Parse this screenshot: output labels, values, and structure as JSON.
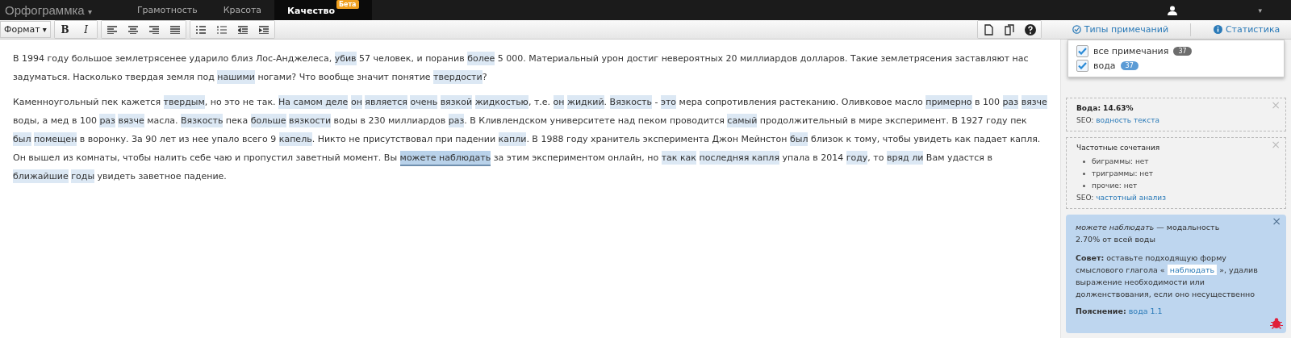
{
  "topbar": {
    "brand": "Орфограммка",
    "brand_caret": "▾",
    "tabs": [
      {
        "label": "Грамотность",
        "selected": false
      },
      {
        "label": "Красота",
        "selected": false
      },
      {
        "label": "Качество",
        "selected": true,
        "badge": "Бета"
      }
    ],
    "user_caret": "▾"
  },
  "toolbar": {
    "format": "Формат",
    "format_caret": "▾",
    "bold": "B",
    "italic": "I",
    "types_link": "Типы примечаний",
    "stats_link": "Статистика"
  },
  "paragraphs": [
    [
      {
        "text": "В 1994 году большое землетрясенее ударило близ Лос-Анджелеса, ",
        "kind": "plain"
      },
      {
        "text": "убив",
        "kind": "note"
      },
      {
        "text": " 57 человек, и поранив ",
        "kind": "plain"
      },
      {
        "text": "более",
        "kind": "note"
      },
      {
        "text": " 5 000. Материальный урон достиг невероятных 20 миллиардов долларов. Такие землетрясения заставляют нас задуматься. Насколько твердая земля под ",
        "kind": "plain"
      },
      {
        "text": "нашими",
        "kind": "note"
      },
      {
        "text": " ногами? Что вообще значит понятие ",
        "kind": "plain"
      },
      {
        "text": "твердости",
        "kind": "note"
      },
      {
        "text": "?",
        "kind": "plain"
      }
    ],
    [
      {
        "text": "Каменноугольный пек кажется ",
        "kind": "plain"
      },
      {
        "text": "твердым",
        "kind": "note"
      },
      {
        "text": ", но это не так. ",
        "kind": "plain"
      },
      {
        "text": "На самом деле",
        "kind": "note"
      },
      {
        "text": "он",
        "kind": "note"
      },
      {
        "text": "является",
        "kind": "note"
      },
      {
        "text": "очень",
        "kind": "note"
      },
      {
        "text": "вязкой",
        "kind": "note"
      },
      {
        "text": "жидкостью",
        "kind": "note"
      },
      {
        "text": ", т.е. ",
        "kind": "plain"
      },
      {
        "text": "он",
        "kind": "note"
      },
      {
        "text": "жидкий",
        "kind": "note"
      },
      {
        "text": ". ",
        "kind": "plain"
      },
      {
        "text": "Вязкость",
        "kind": "note"
      },
      {
        "text": " - ",
        "kind": "plain"
      },
      {
        "text": "это",
        "kind": "note"
      },
      {
        "text": " мера сопротивления растеканию. Оливковое масло ",
        "kind": "plain"
      },
      {
        "text": "примерно",
        "kind": "note"
      },
      {
        "text": " в 100 ",
        "kind": "plain"
      },
      {
        "text": "раз",
        "kind": "note"
      },
      {
        "text": "вязче",
        "kind": "note"
      },
      {
        "text": " воды, а мед в 100 ",
        "kind": "plain"
      },
      {
        "text": "раз",
        "kind": "note"
      },
      {
        "text": "вязче",
        "kind": "note"
      },
      {
        "text": " масла. ",
        "kind": "plain"
      },
      {
        "text": "Вязкость",
        "kind": "note"
      },
      {
        "text": " пека ",
        "kind": "plain"
      },
      {
        "text": "больше",
        "kind": "note"
      },
      {
        "text": "вязкости",
        "kind": "note"
      },
      {
        "text": " воды в 230 миллиардов ",
        "kind": "plain"
      },
      {
        "text": "раз",
        "kind": "note"
      },
      {
        "text": ". В Кливлендском университете над пеком проводится ",
        "kind": "plain"
      },
      {
        "text": "самый",
        "kind": "note"
      },
      {
        "text": " продолжительный в мире эксперимент. В 1927 году пек ",
        "kind": "plain"
      },
      {
        "text": "был",
        "kind": "note"
      },
      {
        "text": "помещен",
        "kind": "note"
      },
      {
        "text": " в воронку. За 90 лет из нее упало всего 9 ",
        "kind": "plain"
      },
      {
        "text": "капель",
        "kind": "note"
      },
      {
        "text": ". Никто не присутствовал при падении ",
        "kind": "plain"
      },
      {
        "text": "капли",
        "kind": "note"
      },
      {
        "text": ". В 1988 году хранитель эксперимента Джон Мейнстон ",
        "kind": "plain"
      },
      {
        "text": "был",
        "kind": "note"
      },
      {
        "text": " близок к тому, чтобы увидеть как падает капля. Он вышел из комнаты, чтобы налить себе чаю и пропустил заветный момент. Вы ",
        "kind": "plain"
      },
      {
        "text": "можете наблюдать",
        "kind": "active"
      },
      {
        "text": " за этим экспериментом онлайн, но ",
        "kind": "plain"
      },
      {
        "text": "так как",
        "kind": "note"
      },
      {
        "text": "последняя капля",
        "kind": "note"
      },
      {
        "text": " упала в 2014 ",
        "kind": "plain"
      },
      {
        "text": "году",
        "kind": "note"
      },
      {
        "text": ", то ",
        "kind": "plain"
      },
      {
        "text": "вряд ли",
        "kind": "note"
      },
      {
        "text": " Вам удастся в ",
        "kind": "plain"
      },
      {
        "text": "ближайшие",
        "kind": "note"
      },
      {
        "text": "годы",
        "kind": "note"
      },
      {
        "text": " увидеть заветное падение.",
        "kind": "plain"
      }
    ]
  ],
  "filters": [
    {
      "label": "все примечания",
      "count": "37",
      "checked": true,
      "color": "#6d6d6d"
    },
    {
      "label": "вода",
      "count": "37",
      "checked": true,
      "color": "#5b9bd5"
    }
  ],
  "water_card": {
    "title": "Вода: 14.63%",
    "seo_label": "SEO:",
    "seo_link": "водность текста",
    "close": "×"
  },
  "freq_card": {
    "title": "Частотные сочетания",
    "items": [
      "биграммы: нет",
      "триграммы: нет",
      "прочие: нет"
    ],
    "seo_label": "SEO:",
    "seo_link": "частотный анализ",
    "close": "×"
  },
  "hint_card": {
    "headline": "*можете наблюдать* — модальность",
    "share": "2.70% от всей воды",
    "advice_label": "Совет:",
    "advice_before": "оставьте подходящую форму смыслового глагола «",
    "advice_word": "наблюдать",
    "advice_after": "», удалив выражение необходимости или долженствования, если оно несущественно",
    "note_label": "Пояснение:",
    "note_link": "вода 1.1",
    "close": "×"
  }
}
